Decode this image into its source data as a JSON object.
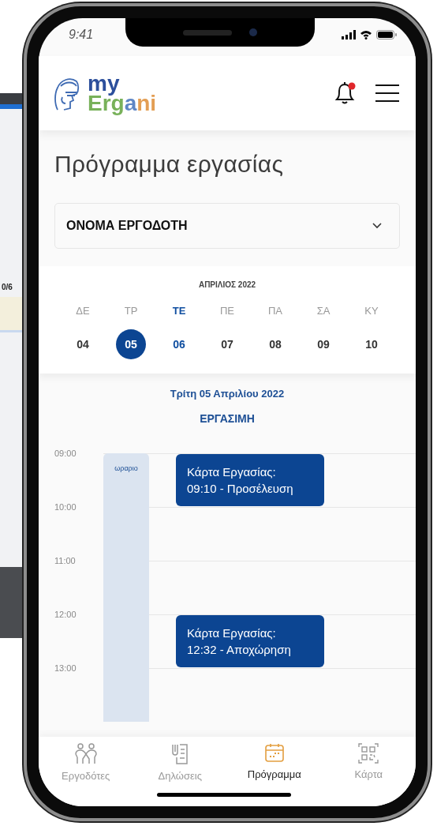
{
  "background_device": {
    "counter": "0/6"
  },
  "status_bar": {
    "time": "9:41"
  },
  "header": {
    "logo_top": "my",
    "logo_bottom_1": "Erg",
    "logo_bottom_2": "a",
    "logo_bottom_3": "ni",
    "notification": true
  },
  "title": "Πρόγραμμα εργασίας",
  "employer_select": {
    "value": "ΟΝΟΜΑ ΕΡΓΟΔΟΤΗ"
  },
  "calendar": {
    "month": "ΑΠΡΙΛΙΟΣ 2022",
    "days": [
      {
        "weekday": "ΔΕ",
        "date": "04",
        "selected": false,
        "today": false
      },
      {
        "weekday": "ΤΡ",
        "date": "05",
        "selected": true,
        "today": false
      },
      {
        "weekday": "ΤΕ",
        "date": "06",
        "selected": false,
        "today": true
      },
      {
        "weekday": "ΠΕ",
        "date": "07",
        "selected": false,
        "today": false
      },
      {
        "weekday": "ΠΑ",
        "date": "08",
        "selected": false,
        "today": false
      },
      {
        "weekday": "ΣΑ",
        "date": "09",
        "selected": false,
        "today": false
      },
      {
        "weekday": "ΚΥ",
        "date": "10",
        "selected": false,
        "today": false
      }
    ]
  },
  "day": {
    "date": "Τρίτη 05 Απριλίου 2022",
    "type": "ΕΡΓΑΣΙΜΗ"
  },
  "timeline": {
    "hours": [
      "09:00",
      "10:00",
      "11:00",
      "12:00",
      "13:00"
    ],
    "schedule_label": "ωραριο",
    "events": [
      {
        "title": "Κάρτα Εργασίας:",
        "detail": "09:10 - Προσέλευση"
      },
      {
        "title": "Κάρτα Εργασίας:",
        "detail": "12:32 - Αποχώρηση"
      }
    ]
  },
  "nav": [
    {
      "kind": "employers",
      "label": "Εργοδότες",
      "selected": false
    },
    {
      "kind": "declarations",
      "label": "Δηλώσεις",
      "selected": false
    },
    {
      "kind": "schedule",
      "label": "Πρόγραμμα",
      "selected": true
    },
    {
      "kind": "card",
      "label": "Κάρτα",
      "selected": false
    }
  ]
}
